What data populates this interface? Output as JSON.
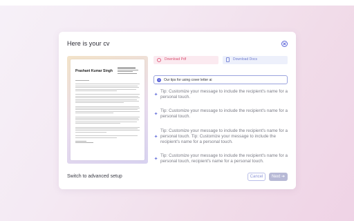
{
  "dialog": {
    "title": "Here is your cv",
    "close_icon": "close-circle-icon"
  },
  "cv": {
    "name": "Prashant Kumar Singh"
  },
  "downloads": {
    "pdf_label": "Download Pdf",
    "pdf_icon": "pdf-circle-icon",
    "docs_label": "Download Docs",
    "docs_icon": "document-icon"
  },
  "tips": {
    "header": "Our tips for using cover letter ai",
    "header_icon": "info-icon",
    "item_icon": "sparkle-icon",
    "items": [
      "Tip: Customize your message to include the recipient's name for a personal touch.",
      "Tip: Customize your message to include the recipient's name for a personal touch.",
      "Tip: Customize your message to include the recipient's name for a personal touch. Tip: Customize your message to include the recipient's name for a personal touch.",
      "Tip: Customize your message to include the recipient's name for a personal touch, recipient's name for a personal touch."
    ]
  },
  "footer": {
    "advanced_label": "Switch to advanced setup",
    "cancel_label": "Cancel",
    "next_label": "Next ➔"
  },
  "colors": {
    "accent": "#5a63d8",
    "pdf_accent": "#d9506f",
    "next_disabled": "#b7b9d6"
  }
}
